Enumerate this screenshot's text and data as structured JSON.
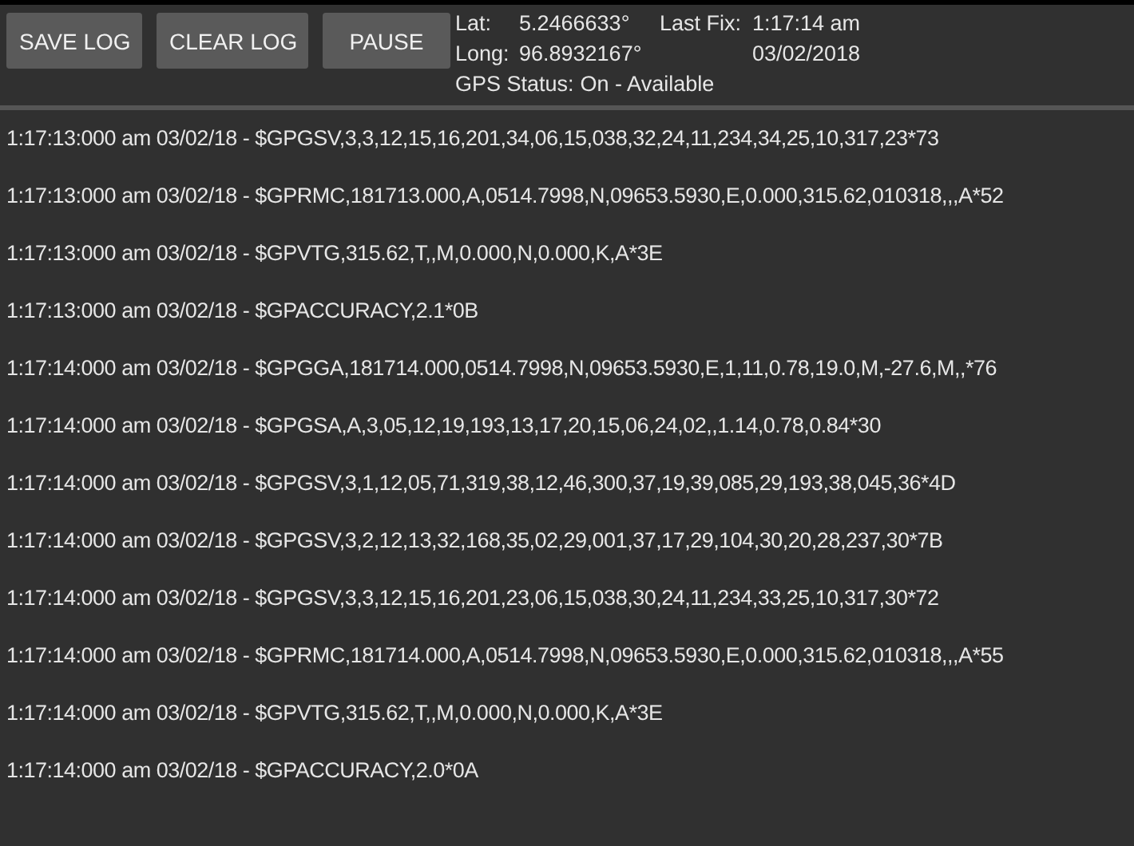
{
  "toolbar": {
    "buttons": [
      {
        "label": "SAVE LOG"
      },
      {
        "label": "CLEAR LOG"
      },
      {
        "label": "PAUSE"
      }
    ]
  },
  "gps_info": {
    "lat_label": "Lat:",
    "lat_value": "5.2466633°",
    "long_label": "Long:",
    "long_value": "96.8932167°",
    "last_fix_label": "Last Fix:",
    "last_fix_time": "1:17:14 am",
    "last_fix_date": "03/02/2018",
    "status_label": "GPS Status:",
    "status_value": "On - Available"
  },
  "log_lines": [
    "1:17:13:000 am 03/02/18 - $GPGSV,3,3,12,15,16,201,34,06,15,038,32,24,11,234,34,25,10,317,23*73",
    "1:17:13:000 am 03/02/18 - $GPRMC,181713.000,A,0514.7998,N,09653.5930,E,0.000,315.62,010318,,,A*52",
    "1:17:13:000 am 03/02/18 - $GPVTG,315.62,T,,M,0.000,N,0.000,K,A*3E",
    "1:17:13:000 am 03/02/18 - $GPACCURACY,2.1*0B",
    "1:17:14:000 am 03/02/18 - $GPGGA,181714.000,0514.7998,N,09653.5930,E,1,11,0.78,19.0,M,-27.6,M,,*76",
    "1:17:14:000 am 03/02/18 - $GPGSA,A,3,05,12,19,193,13,17,20,15,06,24,02,,1.14,0.78,0.84*30",
    "1:17:14:000 am 03/02/18 - $GPGSV,3,1,12,05,71,319,38,12,46,300,37,19,39,085,29,193,38,045,36*4D",
    "1:17:14:000 am 03/02/18 - $GPGSV,3,2,12,13,32,168,35,02,29,001,37,17,29,104,30,20,28,237,30*7B",
    "1:17:14:000 am 03/02/18 - $GPGSV,3,3,12,15,16,201,23,06,15,038,30,24,11,234,33,25,10,317,30*72",
    "1:17:14:000 am 03/02/18 - $GPRMC,181714.000,A,0514.7998,N,09653.5930,E,0.000,315.62,010318,,,A*55",
    "1:17:14:000 am 03/02/18 - $GPVTG,315.62,T,,M,0.000,N,0.000,K,A*3E",
    "1:17:14:000 am 03/02/18 - $GPACCURACY,2.0*0A"
  ]
}
